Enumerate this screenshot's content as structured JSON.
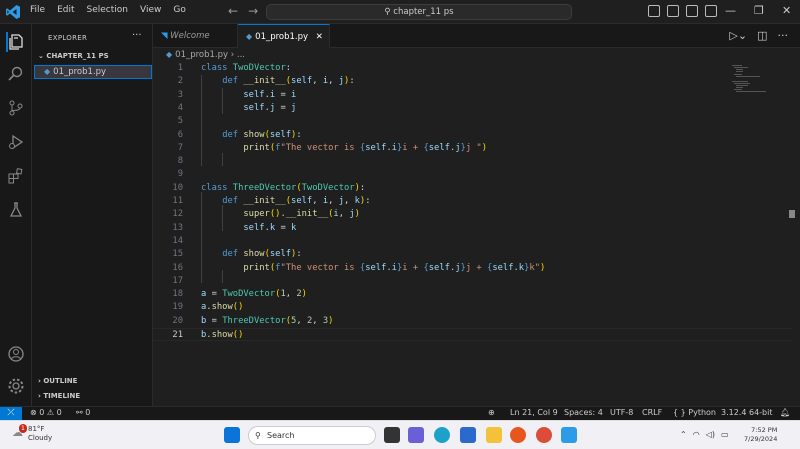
{
  "menu": [
    "File",
    "Edit",
    "Selection",
    "View",
    "Go"
  ],
  "nav": {
    "back": "←",
    "forward": "→"
  },
  "search": {
    "label": "chapter_11 ps"
  },
  "window_controls": {
    "minimize": "—",
    "restore": "❐",
    "close": "✕"
  },
  "explorer": {
    "title": "EXPLORER",
    "more": "···",
    "folder": "CHAPTER_11 PS",
    "file": "01_prob1.py",
    "outline": "OUTLINE",
    "timeline": "TIMELINE"
  },
  "tabs": [
    {
      "label": "Welcome"
    },
    {
      "label": "01_prob1.py",
      "close": "✕"
    }
  ],
  "breadcrumb": {
    "file": "01_prob1.py",
    "sep": "›",
    "rest": "..."
  },
  "code": {
    "lines": [
      "class TwoDVector:",
      "    def __init__(self, i, j):",
      "        self.i = i",
      "        self.j = j",
      "",
      "    def show(self):",
      "        print(f\"The vector is {self.i}i + {self.j}j \")",
      "",
      "",
      "class ThreeDVector(TwoDVector):",
      "    def __init__(self, i, j, k):",
      "        super().__init__(i, j)",
      "        self.k = k",
      "",
      "    def show(self):",
      "        print(f\"The vector is {self.i}i + {self.j}j + {self.k}k\")",
      "",
      "a = TwoDVector(1, 2)",
      "a.show()",
      "b = ThreeDVector(5, 2, 3)",
      "b.show()"
    ],
    "current_line": 21
  },
  "status": {
    "errors": "0",
    "warnings": "0",
    "ports": "0",
    "position": "Ln 21, Col 9",
    "spaces": "Spaces: 4",
    "encoding": "UTF-8",
    "eol": "CRLF",
    "language": "Python",
    "interpreter": "3.12.4 64-bit"
  },
  "taskbar": {
    "temp": "81°F",
    "condition": "Cloudy",
    "badge": "1",
    "search": "Search",
    "time": "7:52 PM",
    "date": "7/29/2024"
  }
}
